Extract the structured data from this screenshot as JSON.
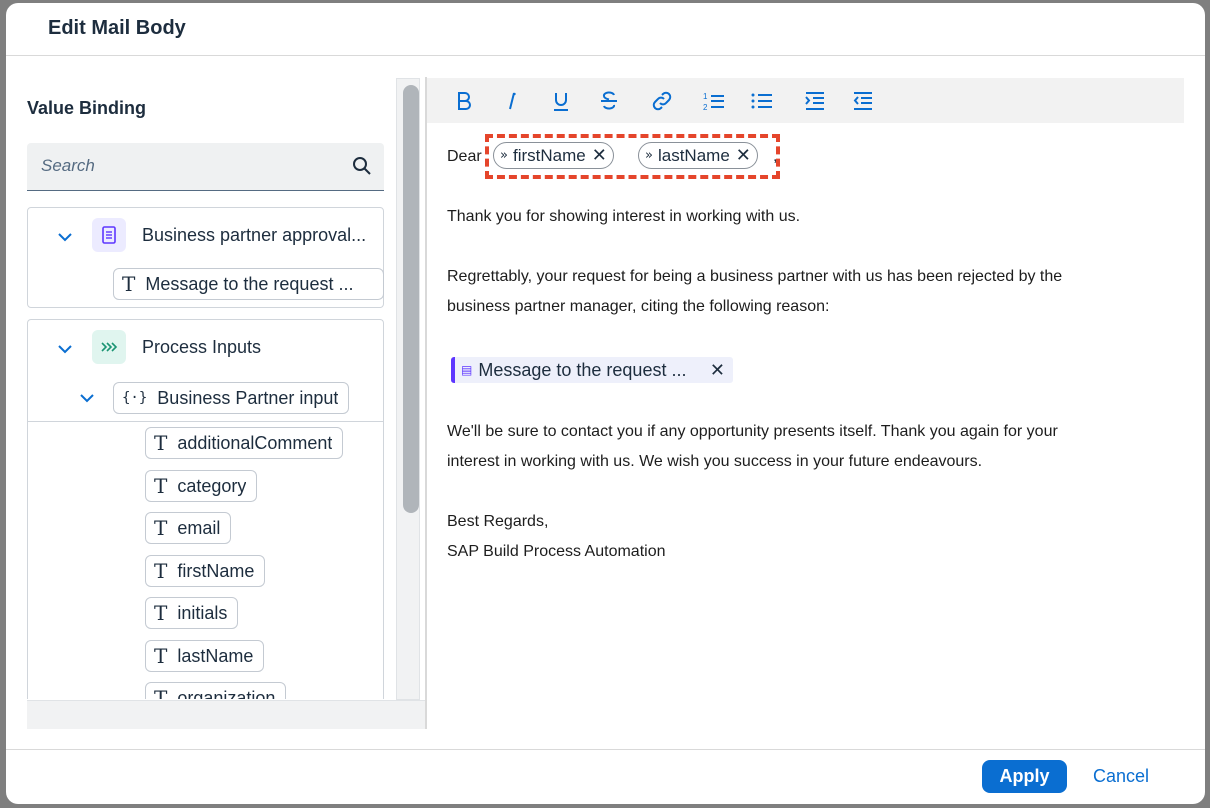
{
  "dialog": {
    "title": "Edit Mail Body"
  },
  "binding": {
    "title": "Value Binding",
    "search_placeholder": "Search",
    "group1": {
      "label": "Business partner approval...",
      "child": "Message to the request ..."
    },
    "group2": {
      "label": "Process Inputs",
      "sub": "Business Partner input",
      "fields": [
        "additionalComment",
        "category",
        "email",
        "firstName",
        "initials",
        "lastName",
        "organization"
      ]
    }
  },
  "toolbar": {
    "buttons": [
      "bold-icon",
      "italic-icon",
      "underline-icon",
      "strikethrough-icon",
      "link-icon",
      "numbered-list-icon",
      "bullet-list-icon",
      "indent-icon",
      "outdent-icon"
    ]
  },
  "editor": {
    "greeting": "Dear",
    "token_first": "firstName",
    "token_last": "lastName",
    "comma": ",",
    "p1": "Thank you for showing interest in working with us.",
    "p2a": "Regrettably, your request for being a business partner with us has been rejected by the",
    "p2b": "business partner manager, citing the following reason:",
    "msg_token": "Message to the request ...",
    "p3a": "We'll be sure to contact you if any opportunity presents itself. Thank you again for your",
    "p3b": "interest in working with us. We wish you success in your future endeavours.",
    "sign1": "Best Regards,",
    "sign2": "SAP Build Process Automation"
  },
  "footer": {
    "apply": "Apply",
    "cancel": "Cancel"
  },
  "colors": {
    "accent": "#0a6ed1",
    "highlight": "#e5452b",
    "form_badge": "#5d36ff"
  }
}
